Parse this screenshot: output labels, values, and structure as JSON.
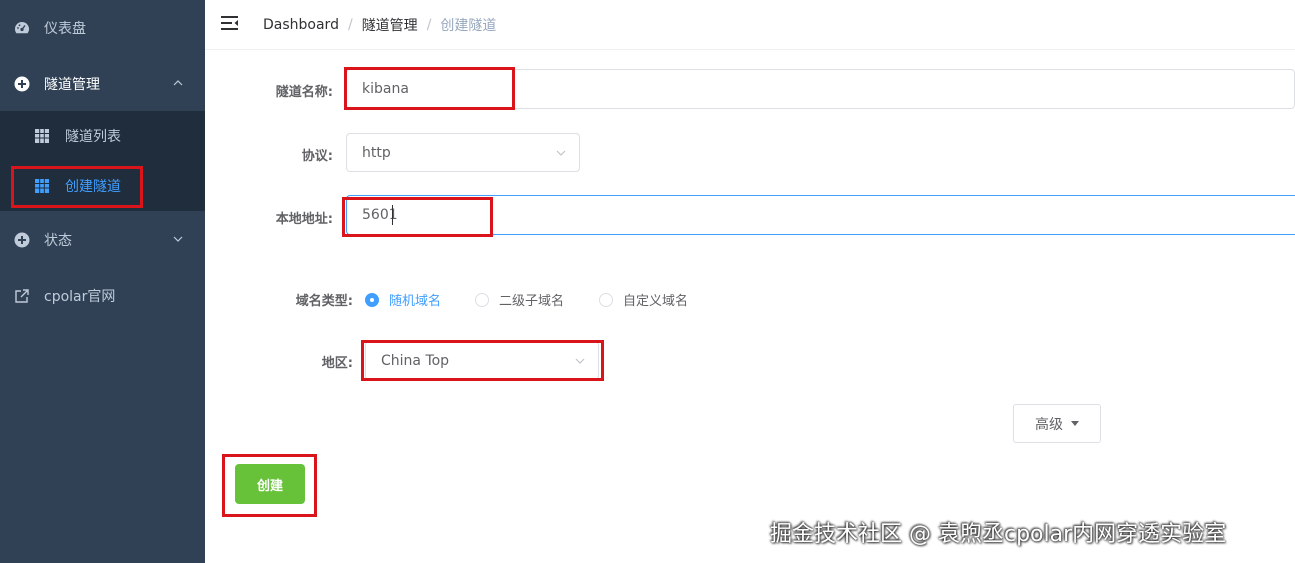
{
  "sidebar": {
    "items": [
      {
        "label": "仪表盘",
        "icon": "dashboard-icon"
      },
      {
        "label": "隧道管理",
        "icon": "plus-circle-icon"
      },
      {
        "label": "状态",
        "icon": "plus-circle-icon"
      },
      {
        "label": "cpolar官网",
        "icon": "external-link-icon"
      }
    ],
    "submenu": [
      {
        "label": "隧道列表",
        "icon": "table-icon"
      },
      {
        "label": "创建隧道",
        "icon": "table-icon",
        "active": true
      }
    ]
  },
  "breadcrumb": [
    "Dashboard",
    "隧道管理",
    "创建隧道"
  ],
  "form": {
    "name_label": "隧道名称:",
    "name_value": "kibana",
    "protocol_label": "协议:",
    "protocol_value": "http",
    "local_label": "本地地址:",
    "local_value": "5601",
    "domain_type_label": "域名类型:",
    "domain_options": [
      "随机域名",
      "二级子域名",
      "自定义域名"
    ],
    "domain_selected": 0,
    "region_label": "地区:",
    "region_value": "China Top",
    "advanced_label": "高级",
    "create_label": "创建"
  },
  "watermark": "掘金技术社区 @ 袁煦丞cpolar内网穿透实验室",
  "colors": {
    "sidebar_bg": "#304156",
    "submenu_bg": "#1f2d3d",
    "accent": "#409eff",
    "create_button": "#67c23a",
    "highlight": "#d9151b"
  }
}
